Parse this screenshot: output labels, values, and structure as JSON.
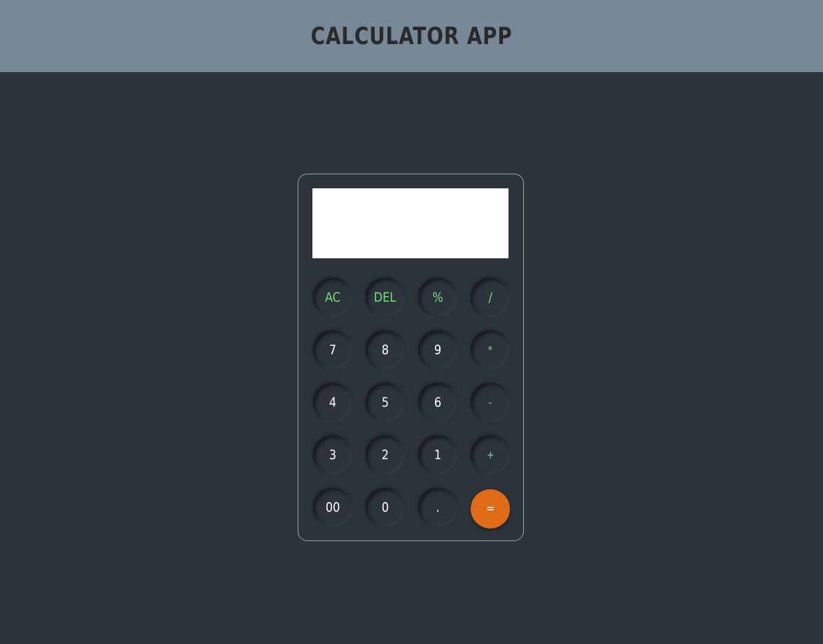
{
  "header": {
    "title": "CALCULATOR APP"
  },
  "display": {
    "value": ""
  },
  "keypad": {
    "row1": {
      "ac": "AC",
      "del": "DEL",
      "percent": "%",
      "divide": "/"
    },
    "row2": {
      "seven": "7",
      "eight": "8",
      "nine": "9",
      "multiply": "*"
    },
    "row3": {
      "four": "4",
      "five": "5",
      "six": "6",
      "minus": "-"
    },
    "row4": {
      "three": "3",
      "two": "2",
      "one": "1",
      "plus": "+"
    },
    "row5": {
      "double_zero": "00",
      "zero": "0",
      "dot": ".",
      "equals": "="
    }
  },
  "colors": {
    "header_bg": "#778899",
    "page_bg": "#2c333d",
    "operator_text": "#7bdc82",
    "equals_bg": "#df6b17"
  }
}
